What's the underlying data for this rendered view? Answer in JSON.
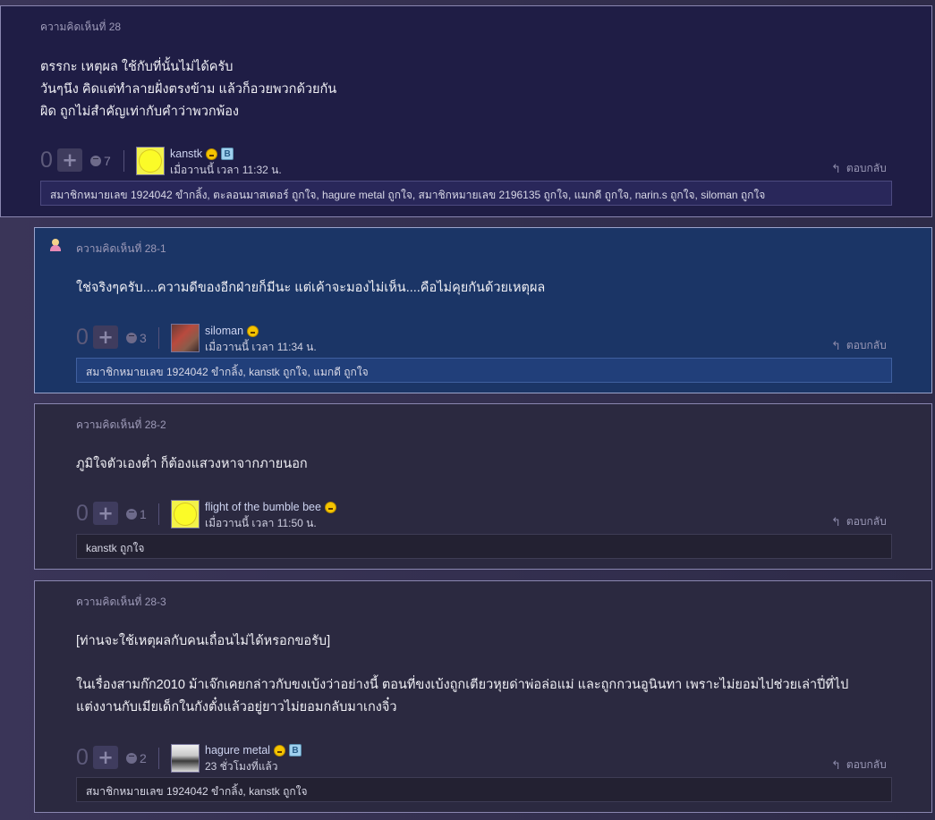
{
  "comments": [
    {
      "number": "ความคิดเห็นที่ 28",
      "lines": [
        "ตรรกะ เหตุผล ใช้กับที่นั้นไม่ได้ครับ",
        "วันๆนึง คิดแต่ทำลายฝั่งตรงข้าม แล้วก็อวยพวกด้วยกัน",
        "ผิด ถูกไม่สำคัญเท่ากับคำว่าพวกพ้อง"
      ],
      "votes": "0",
      "emotion_count": "7",
      "username": "kanstk",
      "time": "เมื่อวานนี้ เวลา 11:32 น.",
      "reply": "ตอบกลับ",
      "likes": "สมาชิกหมายเลข 1924042 ขำกลิ้ง, ตะลอนมาสเตอร์ ถูกใจ, hagure metal ถูกใจ, สมาชิกหมายเลข 2196135 ถูกใจ, แมกดี ถูกใจ, narin.s ถูกใจ, siloman ถูกใจ"
    },
    {
      "number": "ความคิดเห็นที่ 28-1",
      "lines": [
        "ใช่จริงๆครับ....ความดีของอีกฝ่ายก็มีนะ แต่เค้าจะมองไม่เห็น....คือไม่คุยกันด้วยเหตุผล"
      ],
      "votes": "0",
      "emotion_count": "3",
      "username": "siloman",
      "time": "เมื่อวานนี้ เวลา 11:34 น.",
      "reply": "ตอบกลับ",
      "likes": "สมาชิกหมายเลข 1924042 ขำกลิ้ง, kanstk ถูกใจ, แมกดี ถูกใจ"
    },
    {
      "number": "ความคิดเห็นที่ 28-2",
      "lines": [
        "ภูมิใจตัวเองต่ำ ก็ต้องแสวงหาจากภายนอก"
      ],
      "votes": "0",
      "emotion_count": "1",
      "username": "flight of the bumble bee",
      "time": "เมื่อวานนี้ เวลา 11:50 น.",
      "reply": "ตอบกลับ",
      "likes": "kanstk ถูกใจ"
    },
    {
      "number": "ความคิดเห็นที่ 28-3",
      "lines": [
        "[ท่านจะใช้เหตุผลกับคนเถื่อนไม่ได้หรอกขอรับ]",
        "",
        "ในเรื่องสามก๊ก2010 ม้าเจ๊กเคยกล่าวกับขงเบ้งว่าอย่างนี้ ตอนที่ขงเบ้งถูกเตียวหุยด่าพ่อล่อแม่ และถูกกวนอูนินทา เพราะไม่ยอมไปช่วยเล่าปี่ที่ไป",
        "แต่งงานกับเมียเด็กในกังตั๋งแล้วอยู่ยาวไม่ยอมกลับมาเกงจิ๋ว"
      ],
      "votes": "0",
      "emotion_count": "2",
      "username": "hagure metal",
      "time": "23 ชั่วโมงที่แล้ว",
      "reply": "ตอบกลับ",
      "likes": "สมาชิกหมายเลข 1924042 ขำกลิ้ง, kanstk ถูกใจ"
    }
  ],
  "icons": {
    "plus": "+",
    "badge_b": "B",
    "reply": "↰"
  },
  "colors": {
    "main_bg": "#1f1d45",
    "reply_highlight_bg": "#1b3566",
    "reply_bg": "#2b2940",
    "border": "#8a86b0"
  }
}
